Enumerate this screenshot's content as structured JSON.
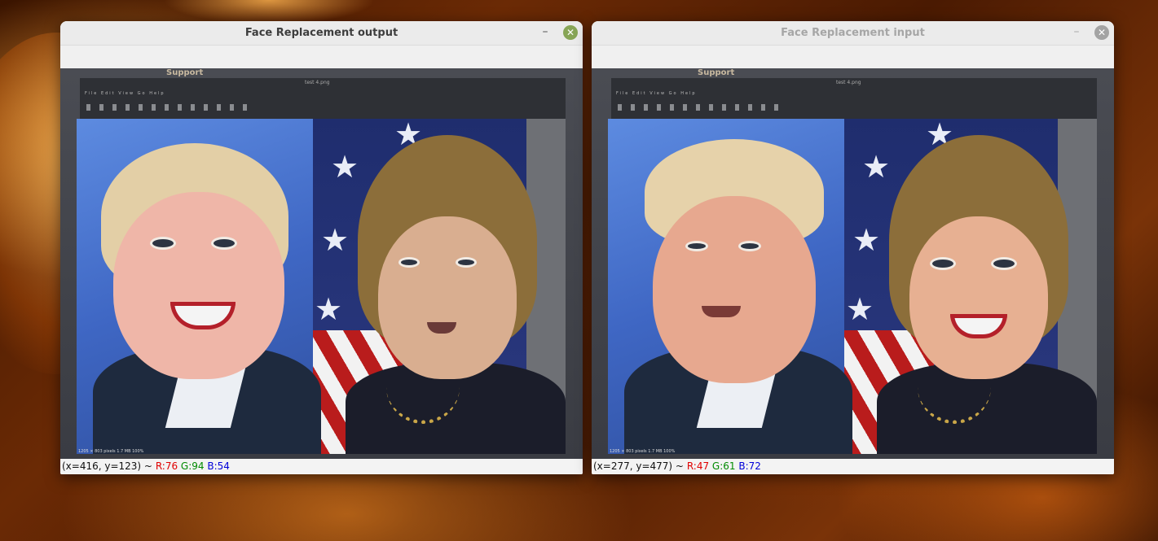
{
  "windows": {
    "output": {
      "title": "Face Replacement output",
      "minimize_glyph": "–",
      "close_glyph": "✕",
      "status": {
        "coords": "(x=416, y=123) ~",
        "r": "R:76",
        "g": "G:94",
        "b": "B:54"
      },
      "image_alt": "face-swapped photo"
    },
    "input": {
      "title": "Face Replacement input",
      "minimize_glyph": "–",
      "close_glyph": "✕",
      "status": {
        "coords": "(x=277, y=477) ~",
        "r": "R:47",
        "g": "G:61",
        "b": "B:72"
      },
      "image_alt": "original photo"
    }
  },
  "photo_text": {
    "support": "Support",
    "screen_title": "test 4.png",
    "screen_menu": "File  Edit  View  Go  Help",
    "screen_status": "1205 × 803 pixels  1.7 MB  100%"
  },
  "colors": {
    "close_active": "#87a556",
    "close_inactive": "#a3a3a3",
    "status_r": "#e00000",
    "status_g": "#008a00",
    "status_b": "#0000d8"
  },
  "icons": {
    "minimize": "minimize-icon",
    "close": "close-icon"
  }
}
